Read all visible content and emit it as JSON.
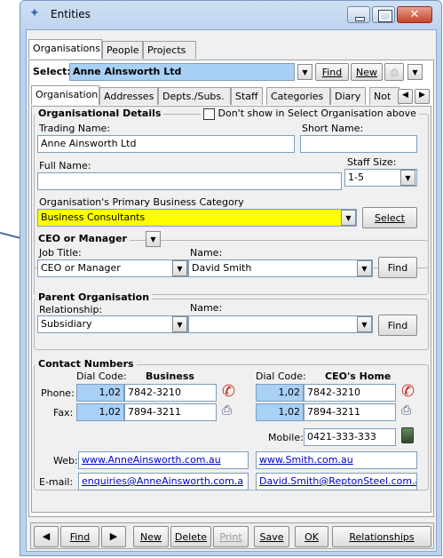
{
  "window": {
    "title": "Entities"
  },
  "top_tabs": [
    "Organisations",
    "People",
    "Projects"
  ],
  "select_bar": {
    "label": "Select:",
    "value": "Anne Ainsworth Ltd",
    "find_label": "Find",
    "new_label": "New"
  },
  "sub_tabs": [
    "Organisation",
    "Addresses",
    "Depts./Subs.",
    "Staff",
    "Categories",
    "Diary",
    "Not"
  ],
  "org_details": {
    "title": "Organisational Details",
    "dont_show_label": "Don't show in Select Organisation above",
    "trading_name_label": "Trading Name:",
    "trading_name_value": "Anne Ainsworth Ltd",
    "short_name_label": "Short Name:",
    "short_name_value": "",
    "full_name_label": "Full Name:",
    "full_name_value": "",
    "staff_size_label": "Staff Size:",
    "staff_size_value": "1-5",
    "category_label": "Organisation's Primary Business Category",
    "category_value": "Business Consultants",
    "select_label": "Select"
  },
  "ceo": {
    "title": "CEO or Manager",
    "job_title_label": "Job Title:",
    "job_title_value": "CEO or Manager",
    "name_label": "Name:",
    "name_value": "David Smith",
    "find_label": "Find"
  },
  "parent": {
    "title": "Parent Organisation",
    "relationship_label": "Relationship:",
    "relationship_value": "Subsidiary",
    "name_label": "Name:",
    "name_value": "",
    "find_label": "Find"
  },
  "contact": {
    "title": "Contact Numbers",
    "dial_code_label": "Dial Code:",
    "business_label": "Business",
    "ceo_home_label": "CEO's Home",
    "phone_label": "Phone:",
    "fax_label": "Fax:",
    "business_phone_code": "1,02",
    "business_phone": "7842-3210",
    "business_fax_code": "1,02",
    "business_fax": "7894-3211",
    "home_phone_code": "1,02",
    "home_phone": "7842-3210",
    "home_fax_code": "1,02",
    "home_fax": "7894-3211",
    "mobile_label": "Mobile:",
    "mobile_value": "0421-333-333",
    "web_label": "Web:",
    "web_business": "www.AnneAinsworth.com.au",
    "web_home": "www.Smith.com.au",
    "email_label": "E-mail:",
    "email_business": "enquiries@AnneAinsworth.com.a",
    "email_home": "David.Smith@ReptonSteel.com.a"
  },
  "bottom": {
    "find": "Find",
    "new": "New",
    "delete": "Delete",
    "print": "Print",
    "save": "Save",
    "ok": "OK",
    "relationships": "Relationships"
  }
}
